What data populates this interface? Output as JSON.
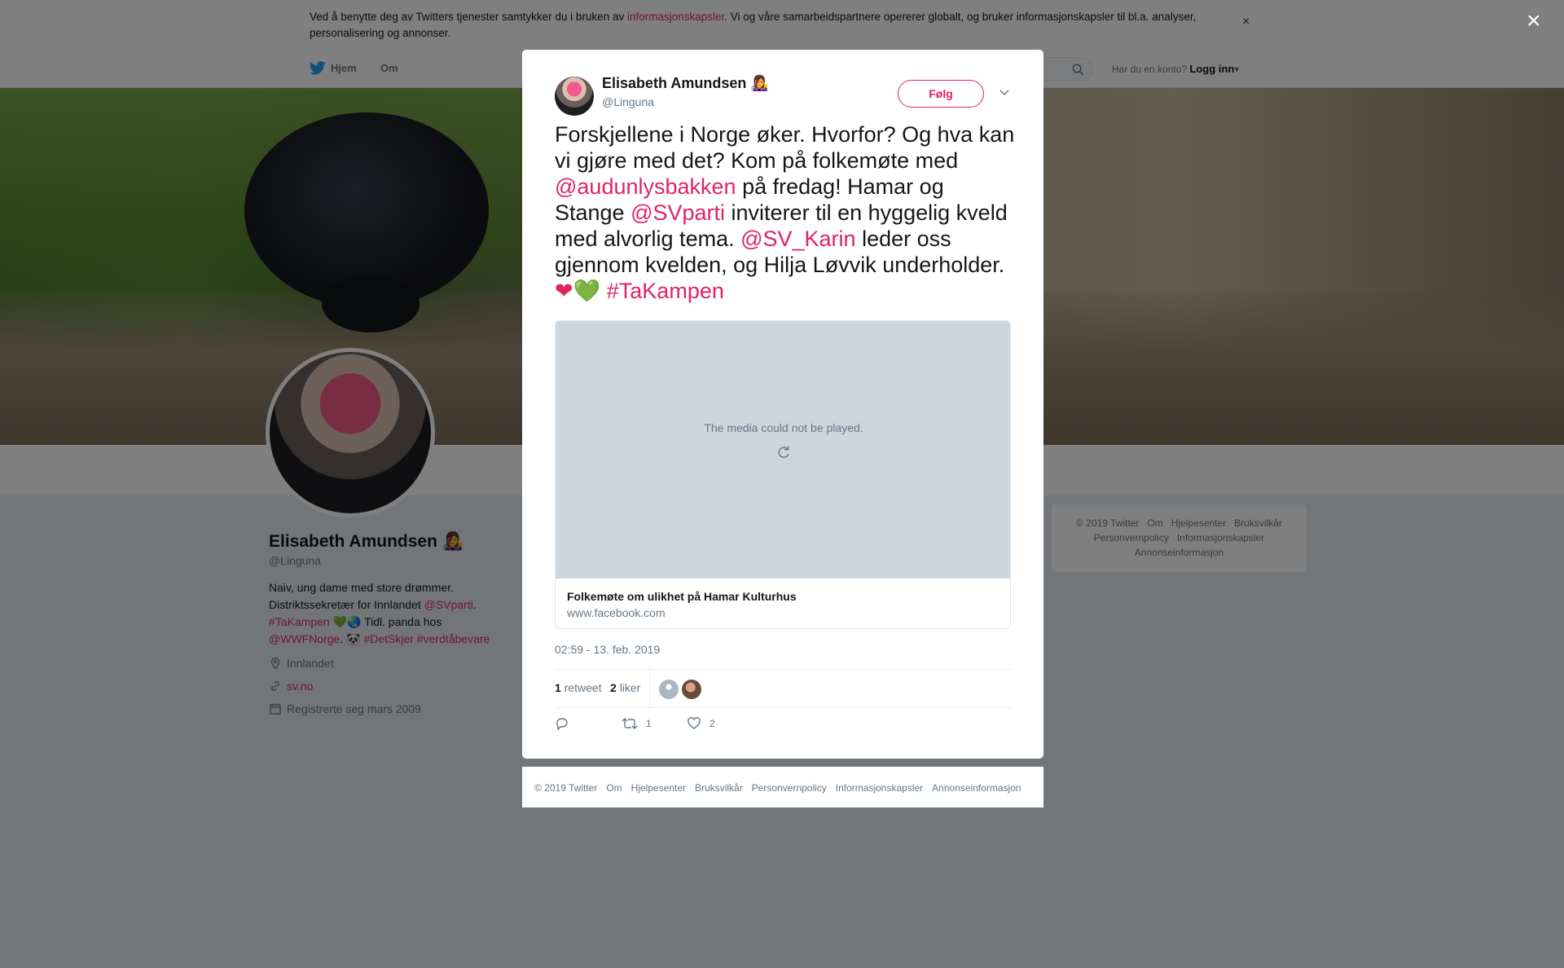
{
  "cookie_bar": {
    "text_before": "Ved å benytte deg av Twitters tjenester samtykker du i bruken av ",
    "link": "informasjonskapsler",
    "text_after": ". Vi og våre samarbeidspartnere opererer globalt, og bruker informasjonskapsler til bl.a. analyser, personalisering og annonser.",
    "close": "×"
  },
  "nav": {
    "home": "Hjem",
    "about": "Om",
    "account_question": "Har du en konto?",
    "login": "Logg inn"
  },
  "profile": {
    "name": "Elisabeth Amundsen 👩‍🎤",
    "handle": "@Linguna",
    "bio_line1": "Naiv, ung dame med store drømmer.",
    "bio_line2_text": "Distriktssekretær for Innlandet ",
    "bio_line2_link": "@SVparti",
    "bio_line2_end": ".",
    "bio_line3_tag": "#TaKampen",
    "bio_line3_text": " 💚🌏 Tidl. panda hos",
    "bio_line4_link": "@WWFNorge",
    "bio_line4_text": ". 🐼 ",
    "bio_line4_tags": "#DetSkjer #verdtåbevare",
    "location": "Innlandet",
    "website": "sv.no",
    "joined": "Registrerte seg mars 2009"
  },
  "side_footer": {
    "items": [
      "© 2019 Twitter",
      "Om",
      "Hjelpesenter",
      "Bruksvilkår",
      "Personvernpolicy",
      "Informasjonskapsler",
      "Annonseinformasjon"
    ]
  },
  "modal": {
    "close": "×",
    "author_name": "Elisabeth Amundsen 👩‍🎤",
    "author_handle": "@Linguna",
    "follow": "Følg",
    "tweet": {
      "p1": "Forskjellene i Norge øker. Hvorfor? Og hva kan vi gjøre med det? Kom på folkemøte med ",
      "m1": "@audunlysbakken",
      "p2": " på fredag! Hamar og Stange ",
      "m2": "@SVparti",
      "p3": " inviterer til en hyggelig kveld med alvorlig tema. ",
      "m3": "@SV_Karin",
      "p4": " leder oss gjennom kvelden, og Hilja Løvvik underholder. ",
      "heart1": "❤",
      "heart2": "💚",
      "tag": "#TaKampen"
    },
    "card": {
      "media_message": "The media could not be played.",
      "title": "Folkemøte om ulikhet på Hamar Kulturhus",
      "url": "www.facebook.com"
    },
    "timestamp": "02:59 - 13. feb. 2019",
    "stats": {
      "retweets_count": "1",
      "retweets_label": "retweet",
      "likes_count": "2",
      "likes_label": "liker"
    },
    "actions": {
      "retweet_count": "1",
      "like_count": "2"
    }
  },
  "modal_footer": {
    "items": [
      "© 2019 Twitter",
      "Om",
      "Hjelpesenter",
      "Bruksvilkår",
      "Personvernpolicy",
      "Informasjonskapsler",
      "Annonseinformasjon"
    ]
  },
  "colors": {
    "accent": "#e0245e",
    "twitter_blue": "#1da1f2"
  }
}
